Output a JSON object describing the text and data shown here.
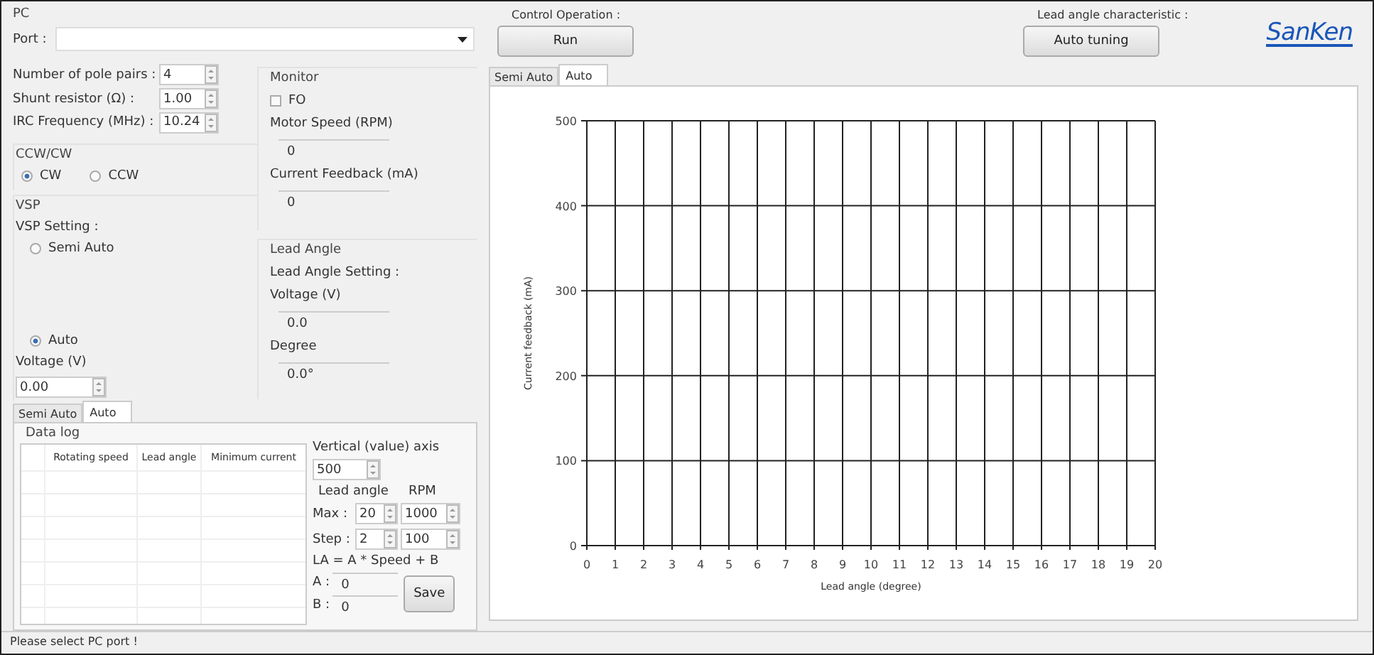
{
  "pc": {
    "title": "PC",
    "port_label": "Port :"
  },
  "control_operation": {
    "label": "Control Operation :",
    "button": "Run"
  },
  "lead_angle_characteristic": {
    "label": "Lead angle characteristic :",
    "button": "Auto tuning"
  },
  "logo": {
    "text": "SanKen"
  },
  "parameters": [
    {
      "label": "Number of pole pairs :",
      "value": "4"
    },
    {
      "label": "Shunt resistor (Ω) :",
      "value": "1.00"
    },
    {
      "label": "IRC Frequency (MHz) :",
      "value": "10.24"
    }
  ],
  "direction": {
    "title": "CCW/CW",
    "options": [
      {
        "label": "CW",
        "selected": true
      },
      {
        "label": "CCW",
        "selected": false
      }
    ]
  },
  "vsp": {
    "title": "VSP",
    "setting_label": "VSP Setting :",
    "options": [
      {
        "label": "Semi Auto",
        "selected": false
      },
      {
        "label": "Auto",
        "selected": true
      }
    ],
    "voltage_label": "Voltage (V)",
    "voltage_value": "0.00"
  },
  "monitor": {
    "title": "Monitor",
    "fo": {
      "label": "FO",
      "checked": false
    },
    "readings": [
      {
        "label": "Motor Speed (RPM)",
        "value": "0"
      },
      {
        "label": "Current Feedback (mA)",
        "value": "0"
      }
    ]
  },
  "lead_angle": {
    "title": "Lead Angle",
    "setting_label": "Lead Angle Setting :",
    "readings": [
      {
        "label": "Voltage (V)",
        "value": "0.0"
      },
      {
        "label": "Degree",
        "value": "0.0°"
      }
    ]
  },
  "left_tabs": [
    {
      "label": "Semi Auto",
      "selected": false
    },
    {
      "label": "Auto",
      "selected": true
    }
  ],
  "data_log": {
    "title": "Data log",
    "columns": [
      "Rotating speed",
      "Lead angle",
      "Minimum current"
    ]
  },
  "auto_settings": {
    "vertical_axis_label": "Vertical (value) axis",
    "vertical_axis_value": "500",
    "column_headers": [
      "Lead angle",
      "RPM"
    ],
    "rows": [
      {
        "label": "Max :",
        "values": [
          "20",
          "1000"
        ]
      },
      {
        "label": "Step :",
        "values": [
          "2",
          "100"
        ]
      }
    ],
    "formula": "LA = A * Speed + B",
    "coefficients": [
      {
        "label": "A :",
        "value": "0"
      },
      {
        "label": "B :",
        "value": "0"
      }
    ],
    "save_button": "Save"
  },
  "chart_tabs": [
    {
      "label": "Semi Auto",
      "selected": false
    },
    {
      "label": "Auto",
      "selected": true
    }
  ],
  "chart": {
    "chart_data": {
      "type": "line",
      "xlabel": "Lead angle (degree)",
      "ylabel": "Current feedback (mA)",
      "xlim": [
        0,
        20
      ],
      "ylim": [
        0,
        500
      ],
      "xticks": [
        0,
        1,
        2,
        3,
        4,
        5,
        6,
        7,
        8,
        9,
        10,
        11,
        12,
        13,
        14,
        15,
        16,
        17,
        18,
        19,
        20
      ],
      "yticks": [
        0,
        100,
        200,
        300,
        400,
        500
      ],
      "grid": true
    }
  },
  "status_bar": {
    "text": "Please select PC port !"
  }
}
